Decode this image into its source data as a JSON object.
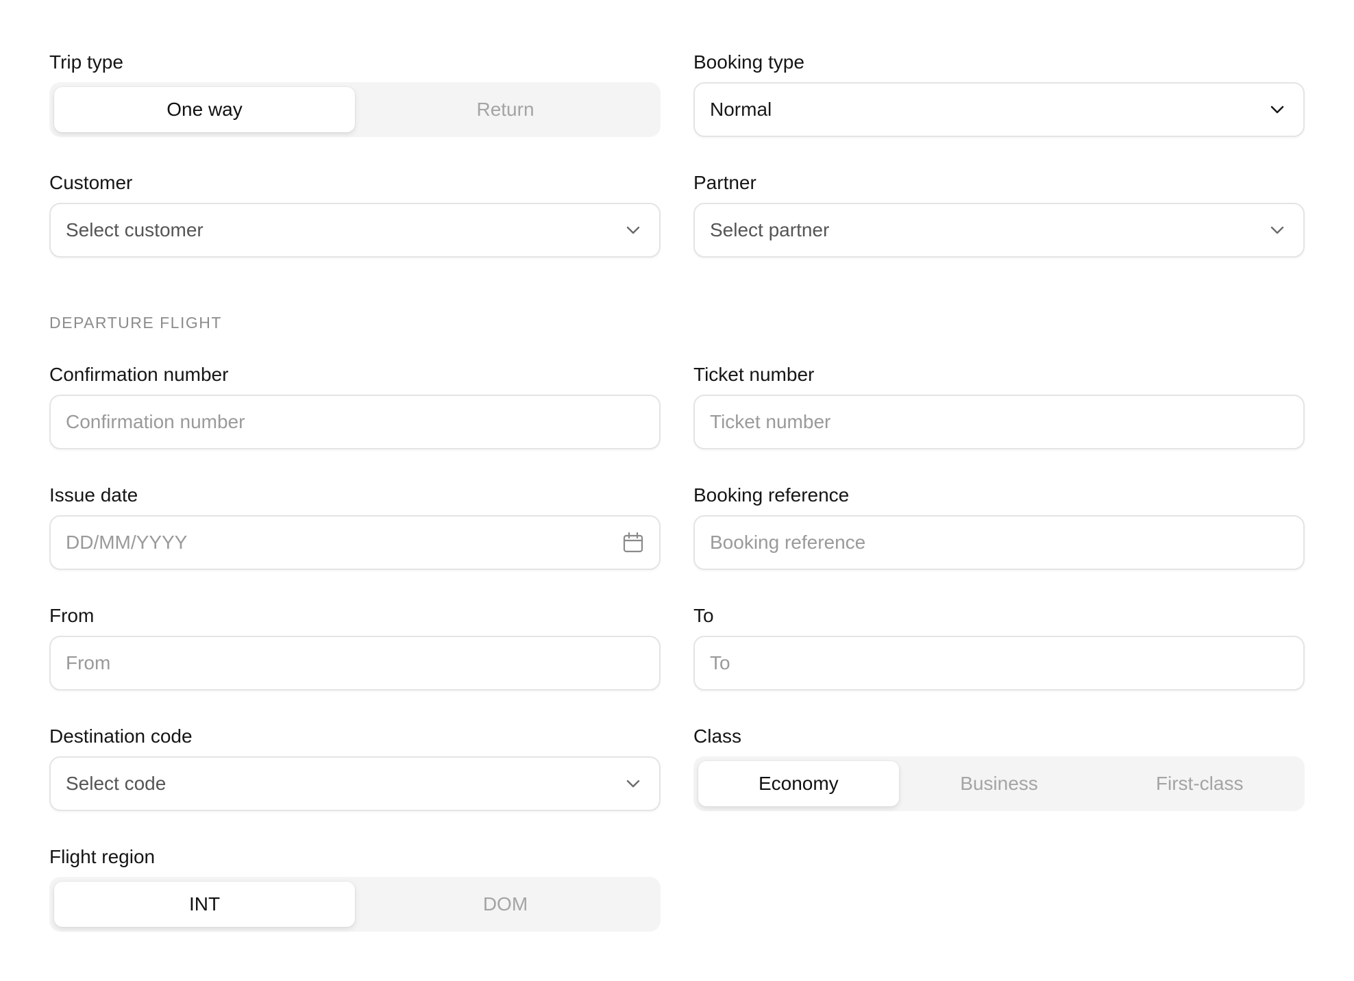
{
  "trip_type": {
    "label": "Trip type",
    "options": [
      "One way",
      "Return"
    ],
    "selected": "One way"
  },
  "booking_type": {
    "label": "Booking type",
    "value": "Normal",
    "icon": "chevron-down-icon"
  },
  "customer": {
    "label": "Customer",
    "placeholder": "Select customer",
    "icon": "chevron-down-icon"
  },
  "partner": {
    "label": "Partner",
    "placeholder": "Select partner",
    "icon": "chevron-down-icon"
  },
  "section": {
    "title": "DEPARTURE FLIGHT"
  },
  "confirmation_number": {
    "label": "Confirmation number",
    "placeholder": "Confirmation number"
  },
  "ticket_number": {
    "label": "Ticket number",
    "placeholder": "Ticket number"
  },
  "issue_date": {
    "label": "Issue date",
    "placeholder": "DD/MM/YYYY",
    "icon": "calendar-icon"
  },
  "booking_reference": {
    "label": "Booking reference",
    "placeholder": "Booking reference"
  },
  "from": {
    "label": "From",
    "placeholder": "From"
  },
  "to": {
    "label": "To",
    "placeholder": "To"
  },
  "destination_code": {
    "label": "Destination code",
    "placeholder": "Select code",
    "icon": "chevron-down-icon"
  },
  "class": {
    "label": "Class",
    "options": [
      "Economy",
      "Business",
      "First-class"
    ],
    "selected": "Economy"
  },
  "flight_region": {
    "label": "Flight region",
    "options": [
      "INT",
      "DOM"
    ],
    "selected": "INT"
  },
  "colors": {
    "border": "#e4e4e4",
    "segment_bg": "#f4f4f4",
    "placeholder": "#9a9a9a",
    "text": "#111111"
  }
}
